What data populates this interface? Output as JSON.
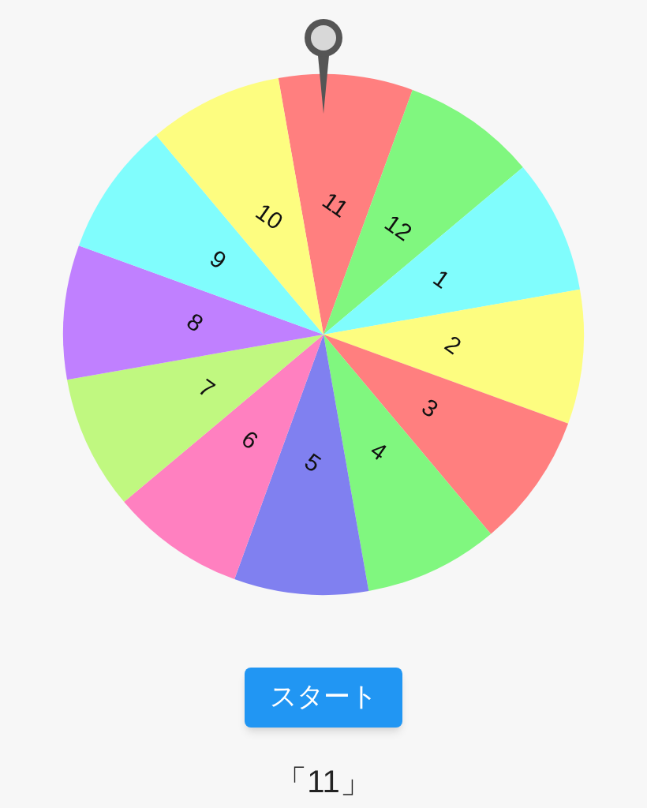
{
  "wheel": {
    "segments": [
      {
        "label": "11",
        "color": "#ff7f7f"
      },
      {
        "label": "12",
        "color": "#80f77f"
      },
      {
        "label": "1",
        "color": "#80fdfd"
      },
      {
        "label": "2",
        "color": "#fdfd80"
      },
      {
        "label": "3",
        "color": "#ff7f7f"
      },
      {
        "label": "4",
        "color": "#80f77f"
      },
      {
        "label": "5",
        "color": "#8080f0"
      },
      {
        "label": "6",
        "color": "#ff80c0"
      },
      {
        "label": "7",
        "color": "#c0f880"
      },
      {
        "label": "8",
        "color": "#c080ff"
      },
      {
        "label": "9",
        "color": "#80fdfd"
      },
      {
        "label": "10",
        "color": "#fdfd80"
      }
    ]
  },
  "start_button": "スタート",
  "result": "「11」"
}
